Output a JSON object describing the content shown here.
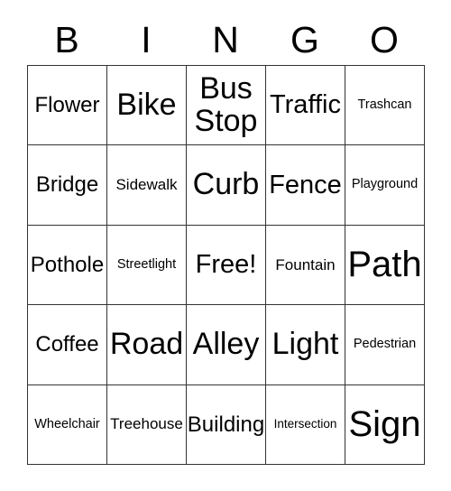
{
  "card": {
    "title": "BINGO",
    "header_letters": [
      "B",
      "I",
      "N",
      "G",
      "O"
    ],
    "rows": [
      [
        {
          "label": "Flower",
          "size": "fs-m"
        },
        {
          "label": "Bike",
          "size": "fs-xl"
        },
        {
          "label": "Bus Stop",
          "size": "fs-xl"
        },
        {
          "label": "Traffic",
          "size": "fs-l"
        },
        {
          "label": "Trashcan",
          "size": "fs-xs"
        }
      ],
      [
        {
          "label": "Bridge",
          "size": "fs-m"
        },
        {
          "label": "Sidewalk",
          "size": "fs-s"
        },
        {
          "label": "Curb",
          "size": "fs-xl"
        },
        {
          "label": "Fence",
          "size": "fs-l"
        },
        {
          "label": "Playground",
          "size": "fs-xs"
        }
      ],
      [
        {
          "label": "Pothole",
          "size": "fs-m"
        },
        {
          "label": "Streetlight",
          "size": "fs-xs"
        },
        {
          "label": "Free!",
          "size": "fs-l"
        },
        {
          "label": "Fountain",
          "size": "fs-s"
        },
        {
          "label": "Path",
          "size": "fs-xxl"
        }
      ],
      [
        {
          "label": "Coffee",
          "size": "fs-m"
        },
        {
          "label": "Road",
          "size": "fs-xl"
        },
        {
          "label": "Alley",
          "size": "fs-xl"
        },
        {
          "label": "Light",
          "size": "fs-xl"
        },
        {
          "label": "Pedestrian",
          "size": "fs-xs"
        }
      ],
      [
        {
          "label": "Wheelchair",
          "size": "fs-xs"
        },
        {
          "label": "Treehouse",
          "size": "fs-s"
        },
        {
          "label": "Building",
          "size": "fs-m"
        },
        {
          "label": "Intersection",
          "size": "fs-xxs"
        },
        {
          "label": "Sign",
          "size": "fs-xxl"
        }
      ]
    ],
    "free_space": "Free!",
    "colors": {
      "background": "#ffffff",
      "text": "#000000",
      "border": "#333333"
    }
  }
}
